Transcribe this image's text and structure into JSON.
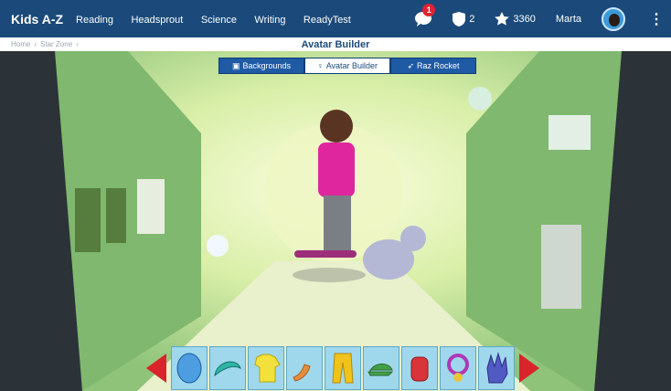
{
  "header": {
    "brand": "Kids A-Z",
    "nav": [
      "Reading",
      "Headsprout",
      "Science",
      "Writing",
      "ReadyTest"
    ],
    "messages_badge": "1",
    "shields": "2",
    "stars": "3360",
    "user": "Marta"
  },
  "breadcrumb": {
    "home": "Home",
    "sep1": "›",
    "current": "Star Zone",
    "sep2": "›"
  },
  "page": {
    "title": "Avatar Builder"
  },
  "tabs": [
    {
      "label": "Backgrounds",
      "icon": "image-icon"
    },
    {
      "label": "Avatar Builder",
      "icon": "person-icon"
    },
    {
      "label": "Raz Rocket",
      "icon": "rocket-icon"
    }
  ],
  "colors": {
    "header": "#1b4a7a",
    "tab": "#1f5aa5",
    "arrow": "#d9242b",
    "slot": "#9fd8ec"
  },
  "items": [
    "head",
    "hair",
    "shirt",
    "arm",
    "pants",
    "cap",
    "backpack",
    "collar",
    "glove"
  ]
}
